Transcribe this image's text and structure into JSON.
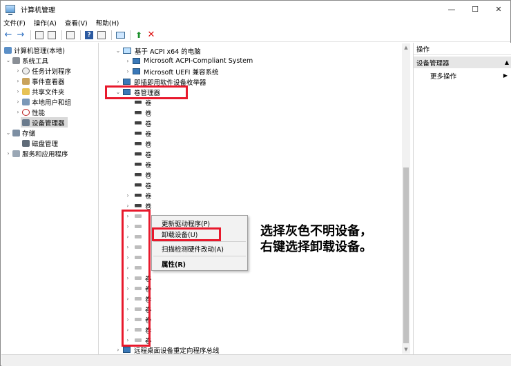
{
  "window": {
    "title": "计算机管理",
    "controls": {
      "minimize": "—",
      "maximize": "☐",
      "close": "✕"
    }
  },
  "menubar": [
    "文件(F)",
    "操作(A)",
    "查看(V)",
    "帮助(H)"
  ],
  "toolbar": {
    "back": "←",
    "forward": "→",
    "help": "?",
    "enable": "⬆",
    "uninstall": "✕"
  },
  "left_tree": [
    {
      "label": "计算机管理(本地)",
      "chev": ""
    },
    {
      "label": "系统工具",
      "chev": "⌄"
    },
    {
      "label": "任务计划程序",
      "chev": "›"
    },
    {
      "label": "事件查看器",
      "chev": "›"
    },
    {
      "label": "共享文件夹",
      "chev": "›"
    },
    {
      "label": "本地用户和组",
      "chev": "›"
    },
    {
      "label": "性能",
      "chev": "›"
    },
    {
      "label": "设备管理器",
      "chev": ""
    },
    {
      "label": "存储",
      "chev": "⌄"
    },
    {
      "label": "磁盘管理",
      "chev": ""
    },
    {
      "label": "服务和应用程序",
      "chev": "›"
    }
  ],
  "device_tree": {
    "acpi_pc": "基于 ACPI x64 的电脑",
    "acpi_system": "Microsoft ACPI-Compliant System",
    "uefi": "Microsoft UEFI 兼容系统",
    "swenum": "即插即用软件设备枚举器",
    "volume_manager": "卷管理器",
    "volume_label": "卷",
    "rdp": "远程桌面设备重定向程序总线"
  },
  "context_menu": {
    "update_driver": "更新驱动程序(P)",
    "uninstall": "卸载设备(U)",
    "scan": "扫描检测硬件改动(A)",
    "properties": "属性(R)"
  },
  "actions": {
    "header": "操作",
    "section": "设备管理器",
    "section_arrow": "▲",
    "more": "更多操作",
    "more_arrow": "▶"
  },
  "annotation": {
    "line1": "选择灰色不明设备，",
    "line2": "右键选择卸载设备。"
  },
  "colors": {
    "highlight": "#e8192c",
    "selected": "#d9d9d9"
  }
}
